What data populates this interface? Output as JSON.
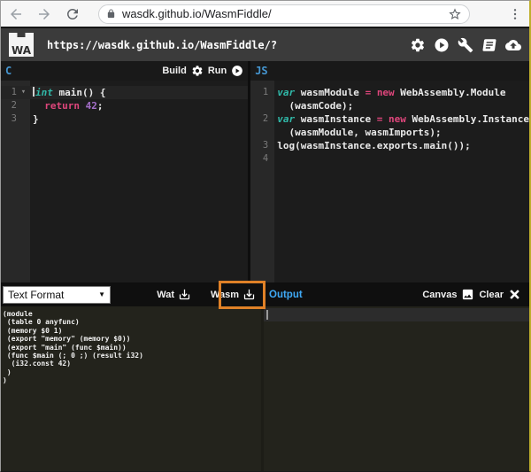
{
  "browser": {
    "url": "wasdk.github.io/WasmFiddle/"
  },
  "app_header": {
    "logo": "WA",
    "url": "https://wasdk.github.io/WasmFiddle/?"
  },
  "panes": {
    "c": {
      "label": "C",
      "build": "Build",
      "run": "Run",
      "rows": [
        {
          "num": "1",
          "fold": "▾",
          "tokens": [
            {
              "t": "int"
            },
            {
              "t": " main() {"
            }
          ]
        },
        {
          "num": "2",
          "fold": "",
          "tokens": [
            {
              "t": "  "
            },
            {
              "t": "return"
            },
            {
              "t": " "
            },
            {
              "t": "42"
            },
            {
              "t": ";"
            }
          ]
        },
        {
          "num": "3",
          "fold": "",
          "tokens": [
            {
              "t": "}"
            }
          ]
        }
      ]
    },
    "js": {
      "label": "JS",
      "rows": [
        {
          "num": "1",
          "tokens": [
            {
              "t": "var"
            },
            {
              "t": " wasmModule "
            },
            {
              "t": "="
            },
            {
              "t": " "
            },
            {
              "t": "new"
            },
            {
              "t": " WebAssembly.Module"
            }
          ]
        },
        {
          "num": "",
          "tokens": [
            {
              "t": "  (wasmCode);"
            }
          ]
        },
        {
          "num": "2",
          "tokens": [
            {
              "t": "var"
            },
            {
              "t": " wasmInstance "
            },
            {
              "t": "="
            },
            {
              "t": " "
            },
            {
              "t": "new"
            },
            {
              "t": " WebAssembly.Instance"
            }
          ]
        },
        {
          "num": "",
          "tokens": [
            {
              "t": "  (wasmModule, wasmImports);"
            }
          ]
        },
        {
          "num": "3",
          "tokens": [
            {
              "t": "log(wasmInstance.exports.main());"
            }
          ]
        },
        {
          "num": "4",
          "tokens": [
            {
              "t": ""
            }
          ]
        }
      ]
    }
  },
  "bottom_bar": {
    "format_select": "Text Format",
    "wat": "Wat",
    "wasm": "Wasm",
    "output": "Output",
    "canvas": "Canvas",
    "clear": "Clear"
  },
  "wat_output": "(module\n (table 0 anyfunc)\n (memory $0 1)\n (export \"memory\" (memory $0))\n (export \"main\" (func $main))\n (func $main (; 0 ;) (result i32)\n  (i32.const 42)\n )\n)",
  "colors": {
    "annotation_orange": "#e08127",
    "lang_label_blue": "#4596d1",
    "output_blue": "#3fa9f5",
    "type_teal": "#30b8a8",
    "keyword_pink": "#e0467c",
    "number_purple": "#a46fc9",
    "header_gray": "#3b3b3b"
  }
}
